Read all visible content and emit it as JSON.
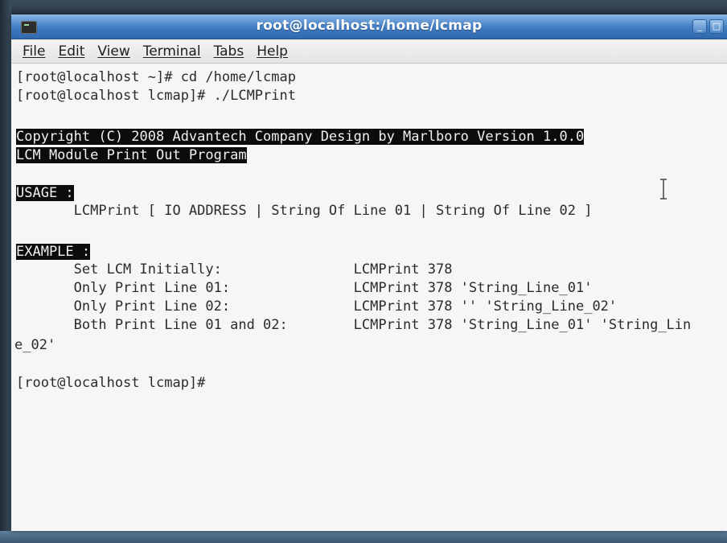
{
  "window": {
    "title": "root@localhost:/home/lcmap",
    "buttons": [
      "_",
      "□"
    ]
  },
  "menu": {
    "items": [
      "File",
      "Edit",
      "View",
      "Terminal",
      "Tabs",
      "Help"
    ]
  },
  "terminal": {
    "lines": [
      "[root@localhost ~]# cd /home/lcmap",
      "[root@localhost lcmap]# ./LCMPrint",
      "",
      "Copyright (C) 2008 Advantech Company Design by Marlboro Version 1.0.0",
      "LCM Module Print Out Program",
      "",
      "USAGE :",
      "       LCMPrint [ IO ADDRESS | String Of Line 01 | String Of Line 02 ]",
      "",
      "EXAMPLE :",
      "       Set LCM Initially:                LCMPrint 378",
      "       Only Print Line 01:               LCMPrint 378 'String_Line_01'",
      "       Only Print Line 02:               LCMPrint 378 '' 'String_Line_02'",
      "       Both Print Line 01 and 02:        LCMPrint 378 'String_Line_01' 'String_Lin",
      "e_02'",
      "",
      "[root@localhost lcmap]#"
    ]
  },
  "colors": {
    "titlebar": "#3f7bc2",
    "terminal_bg": "#f6f6f6",
    "terminal_fg": "#2b2b2b",
    "highlight_bg": "#0c0c0c"
  }
}
